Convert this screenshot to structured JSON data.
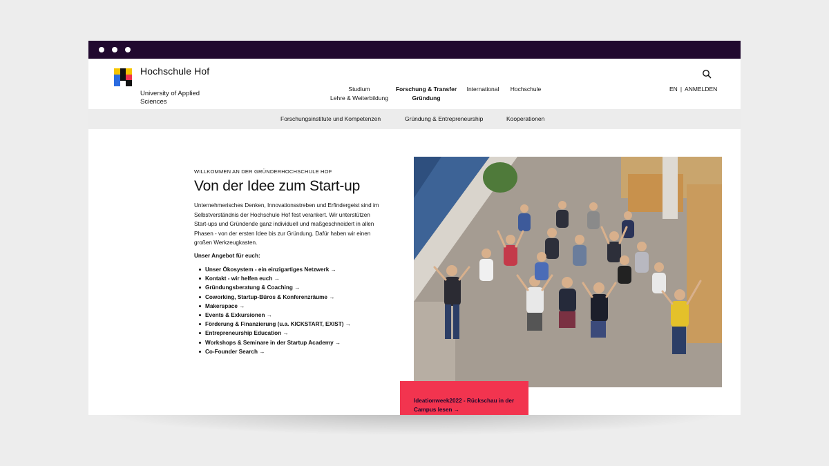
{
  "brand": {
    "name": "Hochschule Hof",
    "subtitle": "University of Applied Sciences",
    "colors": {
      "yellow": "#f5c400",
      "blue": "#2a6be0",
      "black": "#111111",
      "red": "#f2344f"
    }
  },
  "main_nav": [
    {
      "line1": "Studium",
      "line2": "Lehre & Weiterbildung",
      "active": false
    },
    {
      "line1": "Forschung & Transfer",
      "line2": "Gründung",
      "active": true
    },
    {
      "line1": "International",
      "line2": "",
      "active": false
    },
    {
      "line1": "Hochschule",
      "line2": "",
      "active": false
    }
  ],
  "utility": {
    "language": "EN",
    "separator": "|",
    "login": "ANMELDEN",
    "search_icon": "search-icon"
  },
  "sub_nav": [
    "Forschungsinstitute und Kompetenzen",
    "Gründung & Entrepreneurship",
    "Kooperationen"
  ],
  "hero": {
    "eyebrow": "WILLKOMMEN AN DER GRÜNDERHOCHSCHULE HOF",
    "title": "Von der Idee zum Start-up",
    "intro": "Unternehmerisches Denken, Innovationsstreben und Erfindergeist sind im Selbstverständnis der Hochschule Hof fest verankert. Wir unterstützen Start-ups und Gründende ganz individuell und maßgeschneidert in allen Phasen - von der ersten Idee bis zur Gründung. Dafür haben wir einen großen Werkzeugkasten.",
    "offers_title": "Unser Angebot für euch:",
    "offers": [
      "Unser Ökosystem - ein einzigartiges Netzwerk →",
      "Kontakt - wir helfen euch  →",
      "Gründungsberatung & Coaching →",
      "Coworking, Startup-Büros & Konferenzräume →",
      "Makerspace  →",
      "Events & Exkursionen →",
      "Förderung & Finanzierung (u.a. KICKSTART, EXIST) →",
      "Entrepreneurship Education  →",
      "Workshops & Seminare in der Startup Academy →",
      "Co-Founder Search  →"
    ]
  },
  "teaser": {
    "text": "Ideationweek2022 - Rückschau in der Campus lesen →"
  }
}
